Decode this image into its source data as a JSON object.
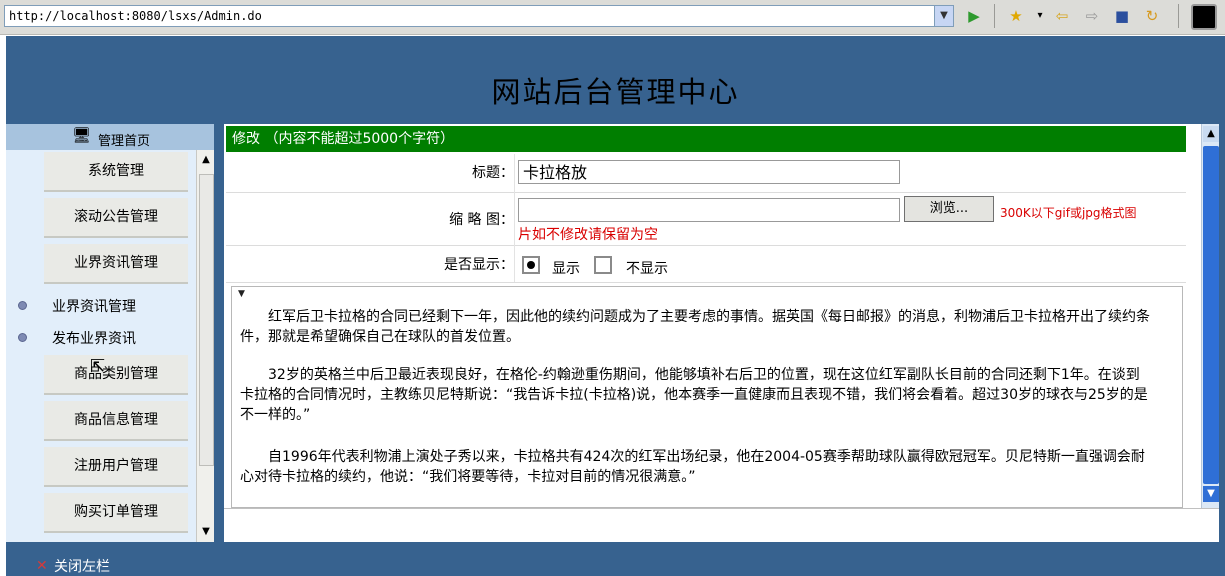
{
  "browser": {
    "url": "http://localhost:8080/lsxs/Admin.do",
    "icons": [
      "dropdown-icon",
      "go-icon",
      "favorites-icon",
      "back-icon",
      "forward-icon",
      "stop-icon",
      "refresh-icon"
    ]
  },
  "header": {
    "title": "网站后台管理中心"
  },
  "sidebar": {
    "home_label": "管理首页",
    "items": [
      "系统管理",
      "滚动公告管理",
      "业界资讯管理",
      "商品类别管理",
      "商品信息管理",
      "注册用户管理",
      "购买订单管理"
    ],
    "subitems": [
      "业界资讯管理",
      "发布业界资讯"
    ]
  },
  "form": {
    "section_title": "修改 （内容不能超过5000个字符）",
    "title_label": "标题：",
    "title_value": "卡拉格放",
    "thumb_label": "缩 略 图：",
    "browse_label": "浏览...",
    "thumb_hint": "300K以下gif或jpg格式图",
    "thumb_hint2": "片如不修改请保留为空",
    "show_label": "是否显示：",
    "show_options": [
      "显示",
      "不显示"
    ],
    "show_selected": "显示"
  },
  "editor": {
    "paragraphs": [
      "红军后卫卡拉格的合同已经剩下一年，因此他的续约问题成为了主要考虑的事情。据英国《每日邮报》的消息，利物浦后卫卡拉格开出了续约条件，那就是希望确保自己在球队的首发位置。",
      "32岁的英格兰中后卫最近表现良好，在格伦-约翰逊重伤期间，他能够填补右后卫的位置，现在这位红军副队长目前的合同还剩下1年。在谈到卡拉格的合同情况时，主教练贝尼特斯说：“我告诉卡拉(卡拉格)说，他本赛季一直健康而且表现不错，我们将会看着。超过30岁的球衣与25岁的是不一样的。”",
      "自1996年代表利物浦上演处子秀以来，卡拉格共有424次的红军出场纪录，他在2004-05赛季帮助球队赢得欧冠冠军。贝尼特斯一直强调会耐心对待卡拉格的续约，他说：“我们将要等待，卡拉对目前的情况很满意。”"
    ]
  },
  "footer": {
    "close_label": "关闭左栏"
  }
}
